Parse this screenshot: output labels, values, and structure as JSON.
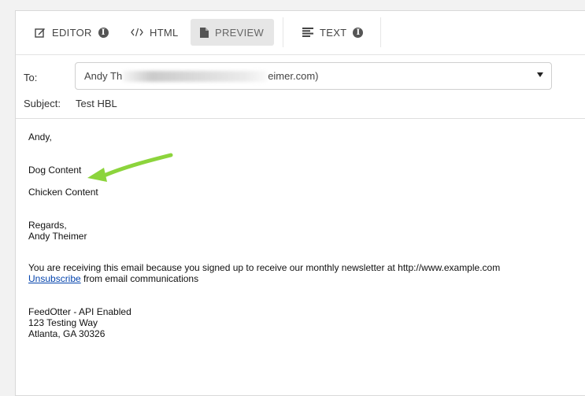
{
  "toolbar": {
    "tabs": [
      {
        "label": "EDITOR",
        "icon": "edit-icon",
        "info": "info-icon"
      },
      {
        "label": "HTML",
        "icon": "code-icon"
      },
      {
        "label": "PREVIEW",
        "icon": "document-icon",
        "active": true
      },
      {
        "label": "TEXT",
        "icon": "text-align-icon",
        "info": "info-icon"
      }
    ]
  },
  "header": {
    "to_label": "To:",
    "to_value_start": "Andy Th",
    "to_value_end": "eimer.com)",
    "subject_label": "Subject:",
    "subject_value": "Test HBL"
  },
  "email": {
    "greeting": "Andy,",
    "line1": "Dog Content",
    "line2": "Chicken Content",
    "regards": "Regards,",
    "signature_name": "Andy Theimer",
    "notice": "You are receiving this email because you signed up to receive our monthly newsletter at http://www.example.com",
    "unsubscribe_link": "Unsubscribe",
    "unsubscribe_rest": " from email communications",
    "company": "FeedOtter - API Enabled",
    "address1": "123 Testing Way",
    "address2": "Atlanta, GA 30326"
  },
  "colors": {
    "arrow": "#8cd43c",
    "link": "#0645ad",
    "active_tab_bg": "#e6e6e6"
  }
}
